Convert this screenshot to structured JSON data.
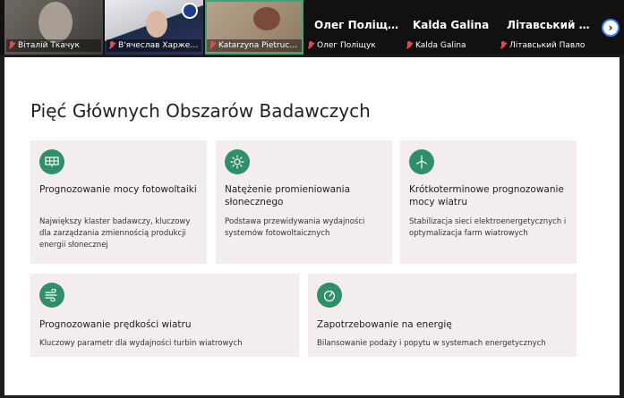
{
  "participants": [
    {
      "name": "Віталій Ткачук",
      "has_video": true
    },
    {
      "name": "В'ячеслав Харжевський",
      "has_video": true
    },
    {
      "name": "Katarzyna Pietrucha-Urba...",
      "has_video": true
    },
    {
      "name": "Олег Поліщук",
      "display_name": "Олег Поліщук",
      "has_video": false
    },
    {
      "name": "Kalda Galina",
      "display_name": "Kalda Galina",
      "has_video": false
    },
    {
      "name": "Літавський Павло",
      "display_name": "Літавський Пав...",
      "has_video": false
    }
  ],
  "next_button_label": "›",
  "slide": {
    "title": "Pięć Głównych Obszarów Badawczych",
    "accent_color": "#2f8f6a",
    "card_background": "#f3eded",
    "cards": [
      {
        "icon": "solar-panel-icon",
        "title": "Prognozowanie mocy fotowoltaiki",
        "description": "Największy klaster badawczy, kluczowy dla zarządzania zmiennością produkcji energii słonecznej"
      },
      {
        "icon": "sun-icon",
        "title": "Natężenie promieniowania słonecznego",
        "description": "Podstawa przewidywania wydajności systemów fotowoltaicznych"
      },
      {
        "icon": "wind-turbine-icon",
        "title": "Krótkoterminowe prognozowanie mocy wiatru",
        "description": "Stabilizacja sieci elektroenergetycznych i optymalizacja farm wiatrowych"
      },
      {
        "icon": "wind-icon",
        "title": "Prognozowanie prędkości wiatru",
        "description": "Kluczowy parametr dla wydajności turbin wiatrowych"
      },
      {
        "icon": "gauge-icon",
        "title": "Zapotrzebowanie na energię",
        "description": "Bilansowanie podaży i popytu w systemach energetycznych"
      }
    ]
  }
}
